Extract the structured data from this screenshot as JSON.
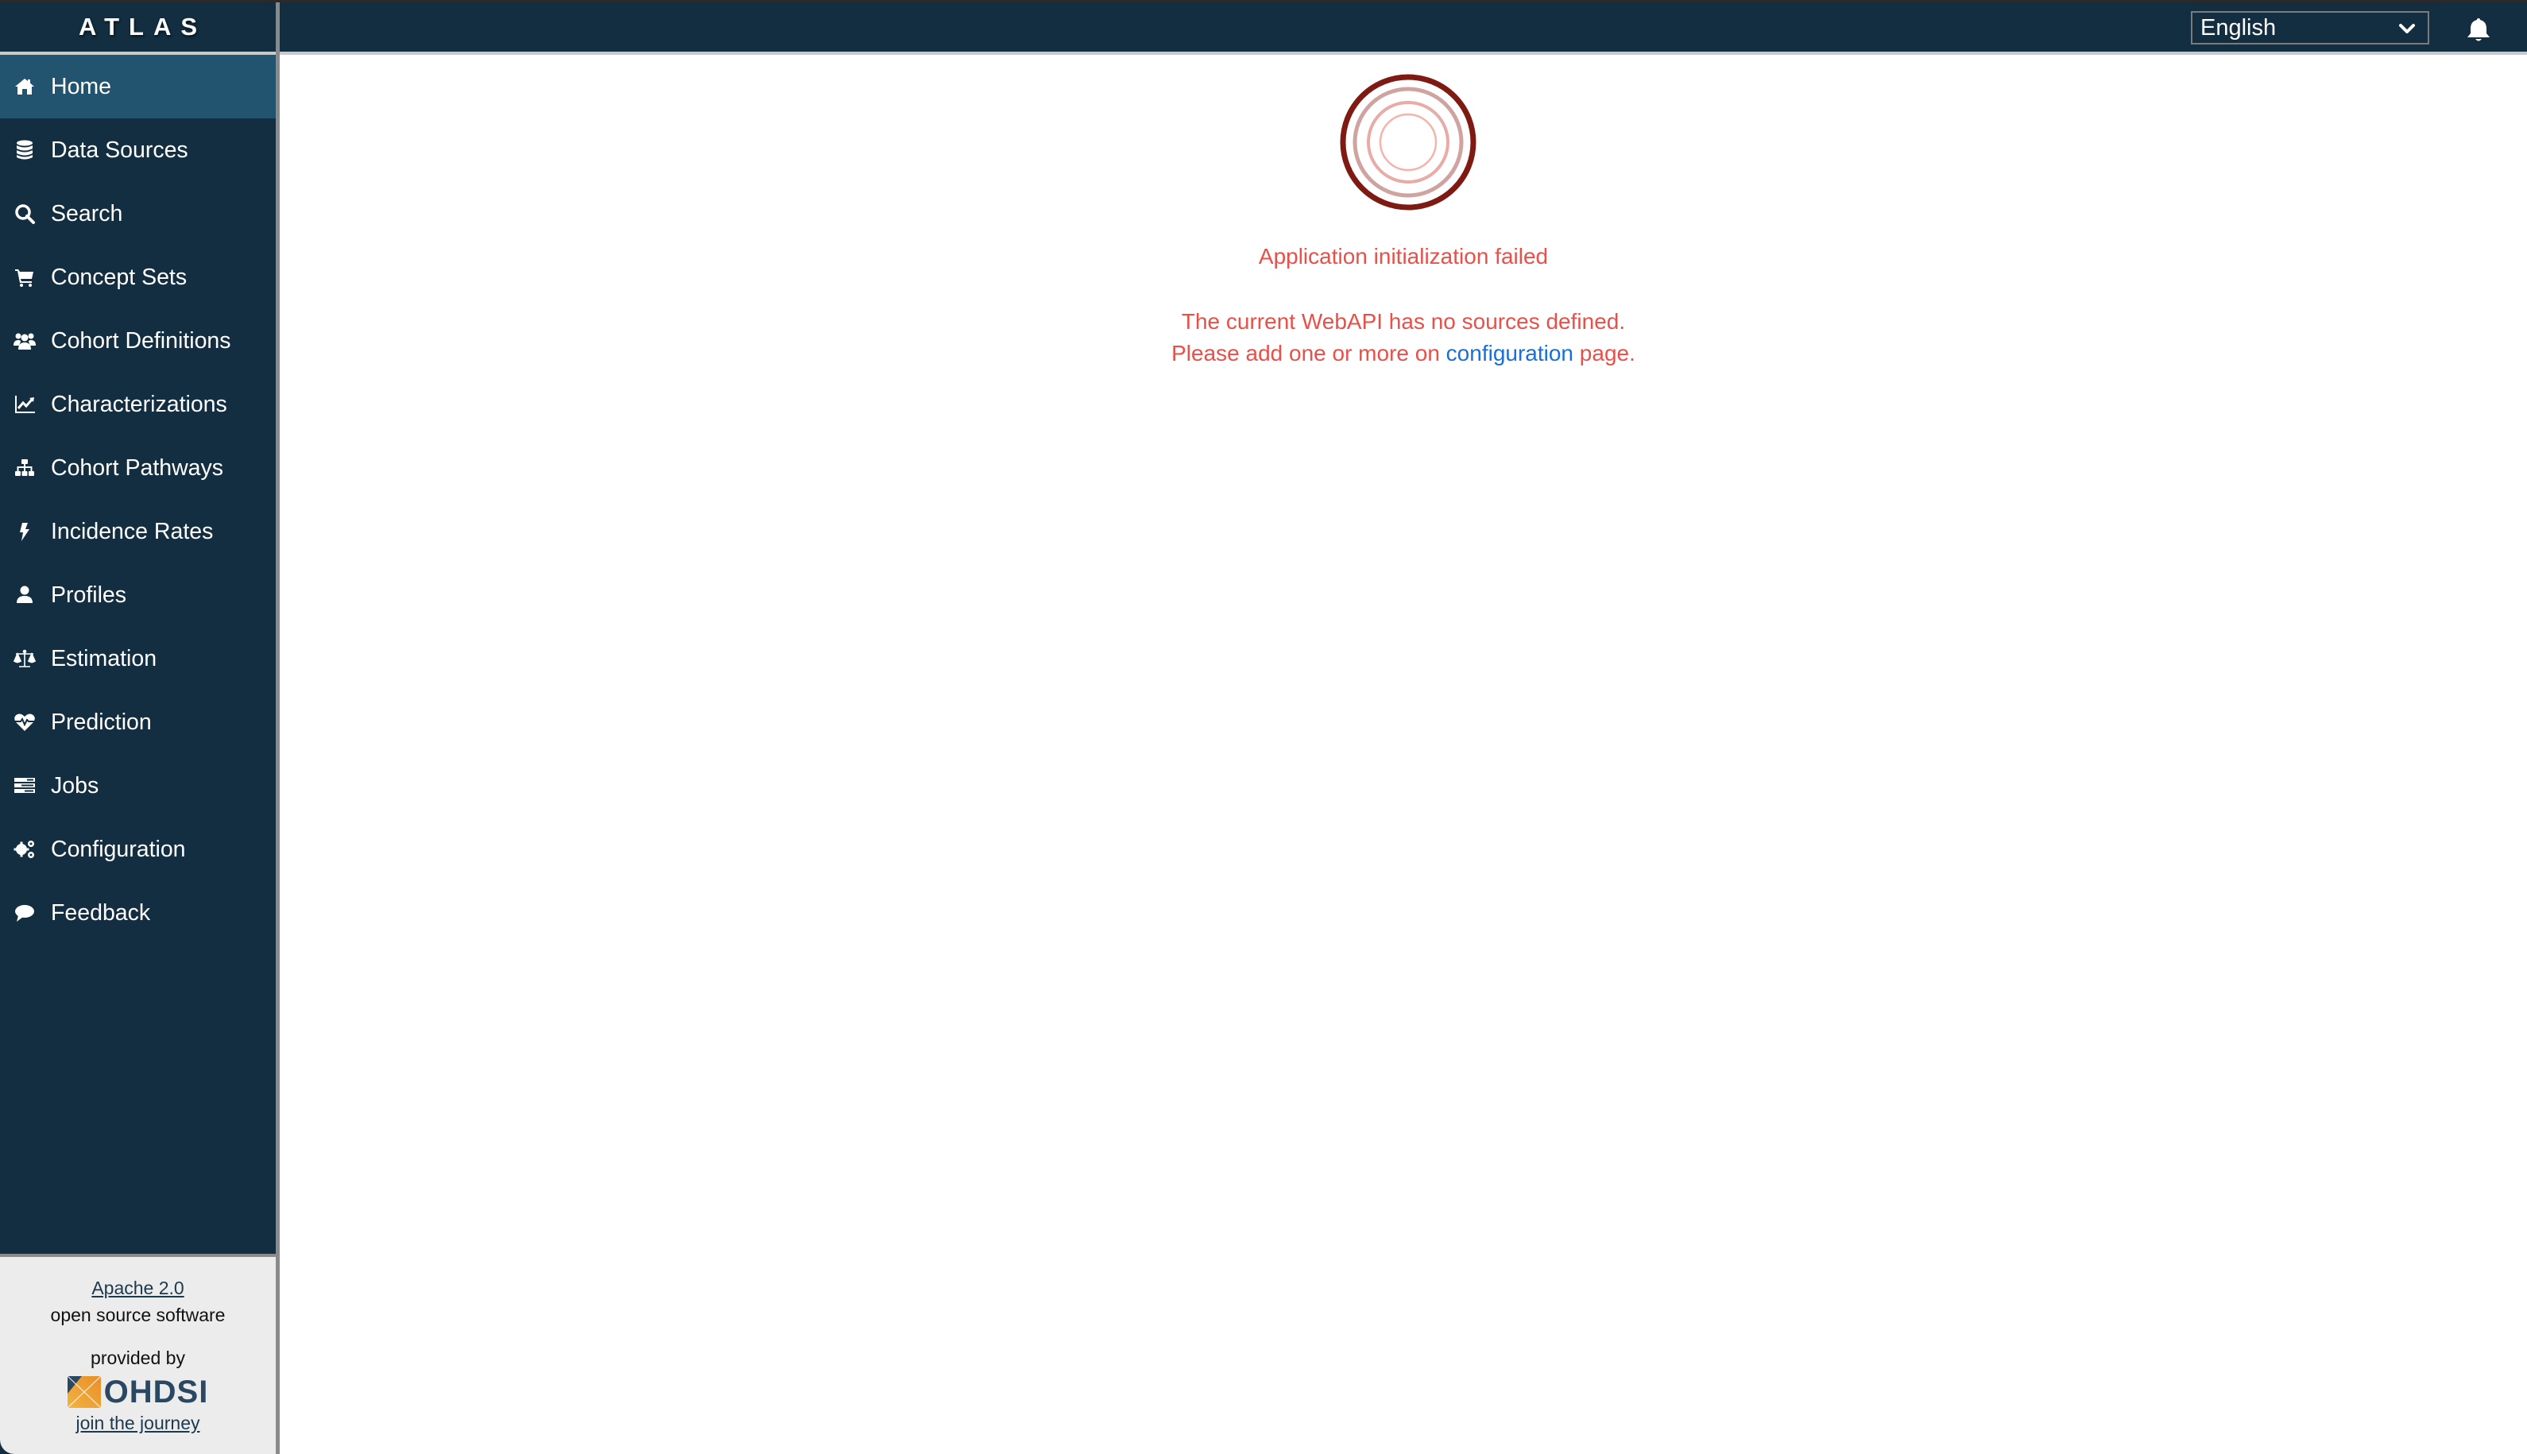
{
  "app": {
    "brand": "ATLAS"
  },
  "sidebar": {
    "items": [
      {
        "label": "Home",
        "icon": "home-icon",
        "active": true
      },
      {
        "label": "Data Sources",
        "icon": "database-icon",
        "active": false
      },
      {
        "label": "Search",
        "icon": "search-icon",
        "active": false
      },
      {
        "label": "Concept Sets",
        "icon": "shopping-cart-icon",
        "active": false
      },
      {
        "label": "Cohort Definitions",
        "icon": "users-icon",
        "active": false
      },
      {
        "label": "Characterizations",
        "icon": "line-chart-icon",
        "active": false
      },
      {
        "label": "Cohort Pathways",
        "icon": "sitemap-icon",
        "active": false
      },
      {
        "label": "Incidence Rates",
        "icon": "bolt-icon",
        "active": false
      },
      {
        "label": "Profiles",
        "icon": "user-icon",
        "active": false
      },
      {
        "label": "Estimation",
        "icon": "balance-scale-icon",
        "active": false
      },
      {
        "label": "Prediction",
        "icon": "heartbeat-icon",
        "active": false
      },
      {
        "label": "Jobs",
        "icon": "tasks-icon",
        "active": false
      },
      {
        "label": "Configuration",
        "icon": "cogs-icon",
        "active": false
      },
      {
        "label": "Feedback",
        "icon": "comment-icon",
        "active": false
      }
    ],
    "footer": {
      "license_link": "Apache 2.0",
      "license_text": "open source software",
      "provided_by": "provided by",
      "org_name": "OHDSI",
      "join_link": "join the journey"
    }
  },
  "header": {
    "language": {
      "selected": "English"
    },
    "notifications_icon": "bell-icon"
  },
  "main": {
    "error_title": "Application initialization failed",
    "error_line1": "The current WebAPI has no sources defined.",
    "error_line2_prefix": "Please add one or more on ",
    "error_line2_link": "configuration",
    "error_line2_suffix": " page."
  },
  "colors": {
    "sidebar_bg": "#122e40",
    "active_item_bg": "#22536f",
    "error_text": "#e8504a",
    "link": "#1a6fd6",
    "spinner_outer": "#7f1a12"
  }
}
